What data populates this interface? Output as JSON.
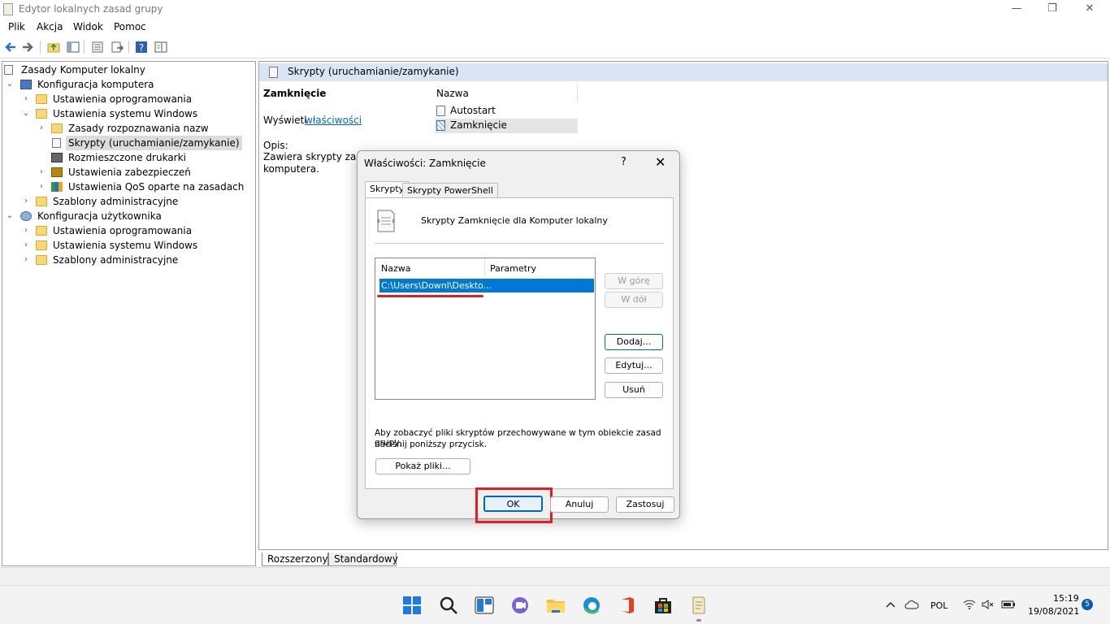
{
  "window": {
    "title": "Edytor lokalnych zasad grupy",
    "minimize": "—",
    "maximize": "❐",
    "close": "✕"
  },
  "menu": [
    "Plik",
    "Akcja",
    "Widok",
    "Pomoc"
  ],
  "tree": {
    "root": "Zasady Komputer lokalny",
    "items": [
      {
        "label": "Konfiguracja komputera",
        "icon": "computer-icon"
      },
      {
        "label": "Ustawienia oprogramowania",
        "icon": "folder-icon"
      },
      {
        "label": "Ustawienia systemu Windows",
        "icon": "folder-icon"
      },
      {
        "label": "Zasady rozpoznawania nazw",
        "icon": "folder-icon"
      },
      {
        "label": "Skrypty (uruchamianie/zamykanie)",
        "icon": "script-icon"
      },
      {
        "label": "Rozmieszczone drukarki",
        "icon": "printer-icon"
      },
      {
        "label": "Ustawienia zabezpieczeń",
        "icon": "security-icon"
      },
      {
        "label": "Ustawienia QoS oparte na zasadach",
        "icon": "qos-chart-icon"
      },
      {
        "label": "Szablony administracyjne",
        "icon": "folder-icon"
      },
      {
        "label": "Konfiguracja użytkownika",
        "icon": "user-icon"
      },
      {
        "label": "Ustawienia oprogramowania",
        "icon": "folder-icon"
      },
      {
        "label": "Ustawienia systemu Windows",
        "icon": "folder-icon"
      },
      {
        "label": "Szablony administracyjne",
        "icon": "folder-icon"
      }
    ]
  },
  "right": {
    "header": "Skrypty (uruchamianie/zamykanie)",
    "heading": "Zamknięcie",
    "show_prefix": "Wyświetl",
    "show_link": "właściwości",
    "desc_label": "Opis:",
    "desc_line1": "Zawiera skrypty zamy",
    "desc_line2": "komputera.",
    "col_name": "Nazwa",
    "items": [
      "Autostart",
      "Zamknięcie"
    ]
  },
  "bottom_tabs": [
    "Rozszerzony",
    "Standardowy"
  ],
  "dialog": {
    "title": "Właściwości: Zamknięcie",
    "help": "?",
    "close": "✕",
    "tabs": [
      "Skrypty",
      "Skrypty PowerShell"
    ],
    "header_text": "Skrypty Zamknięcie dla Komputer lokalny",
    "columns": [
      "Nazwa",
      "Parametry"
    ],
    "row": "C:\\Users\\Downl\\Deskto...",
    "side_buttons": [
      "W górę",
      "W dół",
      "Dodaj...",
      "Edytuj...",
      "Usuń"
    ],
    "info_line1": "Aby zobaczyć pliki skryptów przechowywane w tym obiekcie zasad grupy,",
    "info_line2": "naciśnij poniższy przycisk.",
    "show_files": "Pokaż pliki...",
    "ok": "OK",
    "cancel": "Anuluj",
    "apply": "Zastosuj"
  },
  "taskbar": {
    "lang": "POL",
    "time": "15:19",
    "date": "19/08/2021",
    "badge": "5"
  },
  "colors": {
    "accent": "#0078d4",
    "highlight_box": "#e02020",
    "header_band": "#d9e4f5"
  }
}
